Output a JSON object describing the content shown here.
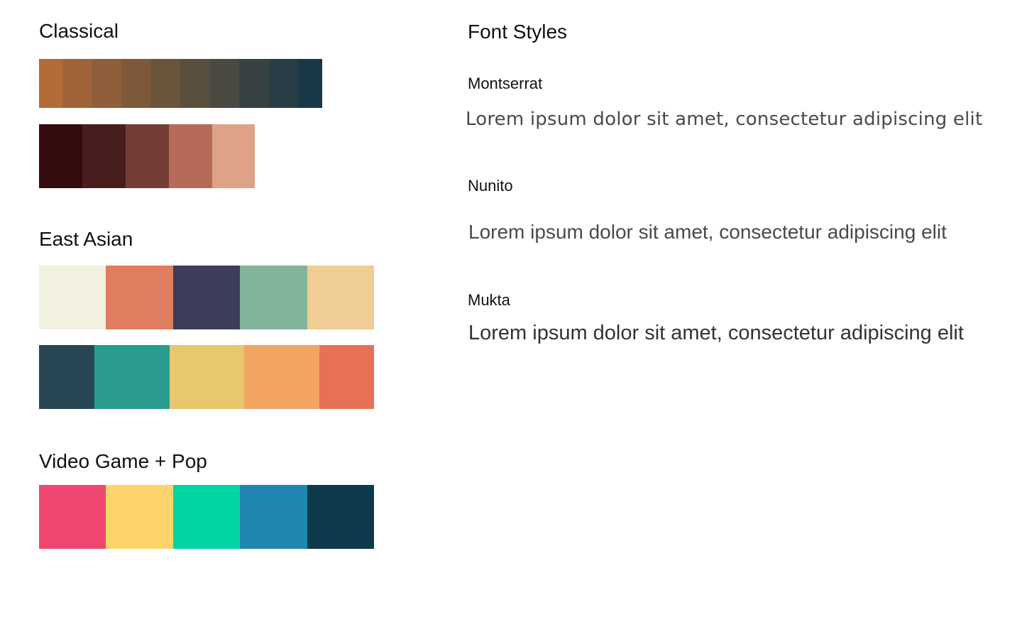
{
  "palettes": {
    "classical": {
      "title": "Classical",
      "row1": [
        "#B56B37",
        "#A1643A",
        "#8E5E3A",
        "#7D5839",
        "#6B543C",
        "#5A4F3E",
        "#4A4A42",
        "#384243",
        "#283D45",
        "#173847"
      ],
      "row2": [
        "#350C0E",
        "#481D1E",
        "#743D36",
        "#B86A59",
        "#DEA386"
      ]
    },
    "east_asian": {
      "title": "East Asian",
      "row1": [
        "#F2F0DF",
        "#E07C5F",
        "#3D3D5A",
        "#82B39B",
        "#F0CE93"
      ],
      "row2": [
        "#284654",
        "#2A9C8F",
        "#E8C76F",
        "#F2A463",
        "#E67154"
      ]
    },
    "video_game_pop": {
      "title": "Video Game + Pop",
      "row1": [
        "#EF476F",
        "#FDD46B",
        "#00D6A3",
        "#1F87B1",
        "#0E3B4B"
      ]
    }
  },
  "fonts": {
    "title": "Font Styles",
    "items": [
      {
        "name": "Montserrat",
        "sample": "Lorem ipsum dolor sit amet, consectetur adipiscing elit"
      },
      {
        "name": "Nunito",
        "sample": "Lorem ipsum dolor sit amet, consectetur adipiscing elit"
      },
      {
        "name": "Mukta",
        "sample": "Lorem ipsum dolor sit amet, consectetur adipiscing elit"
      }
    ]
  }
}
